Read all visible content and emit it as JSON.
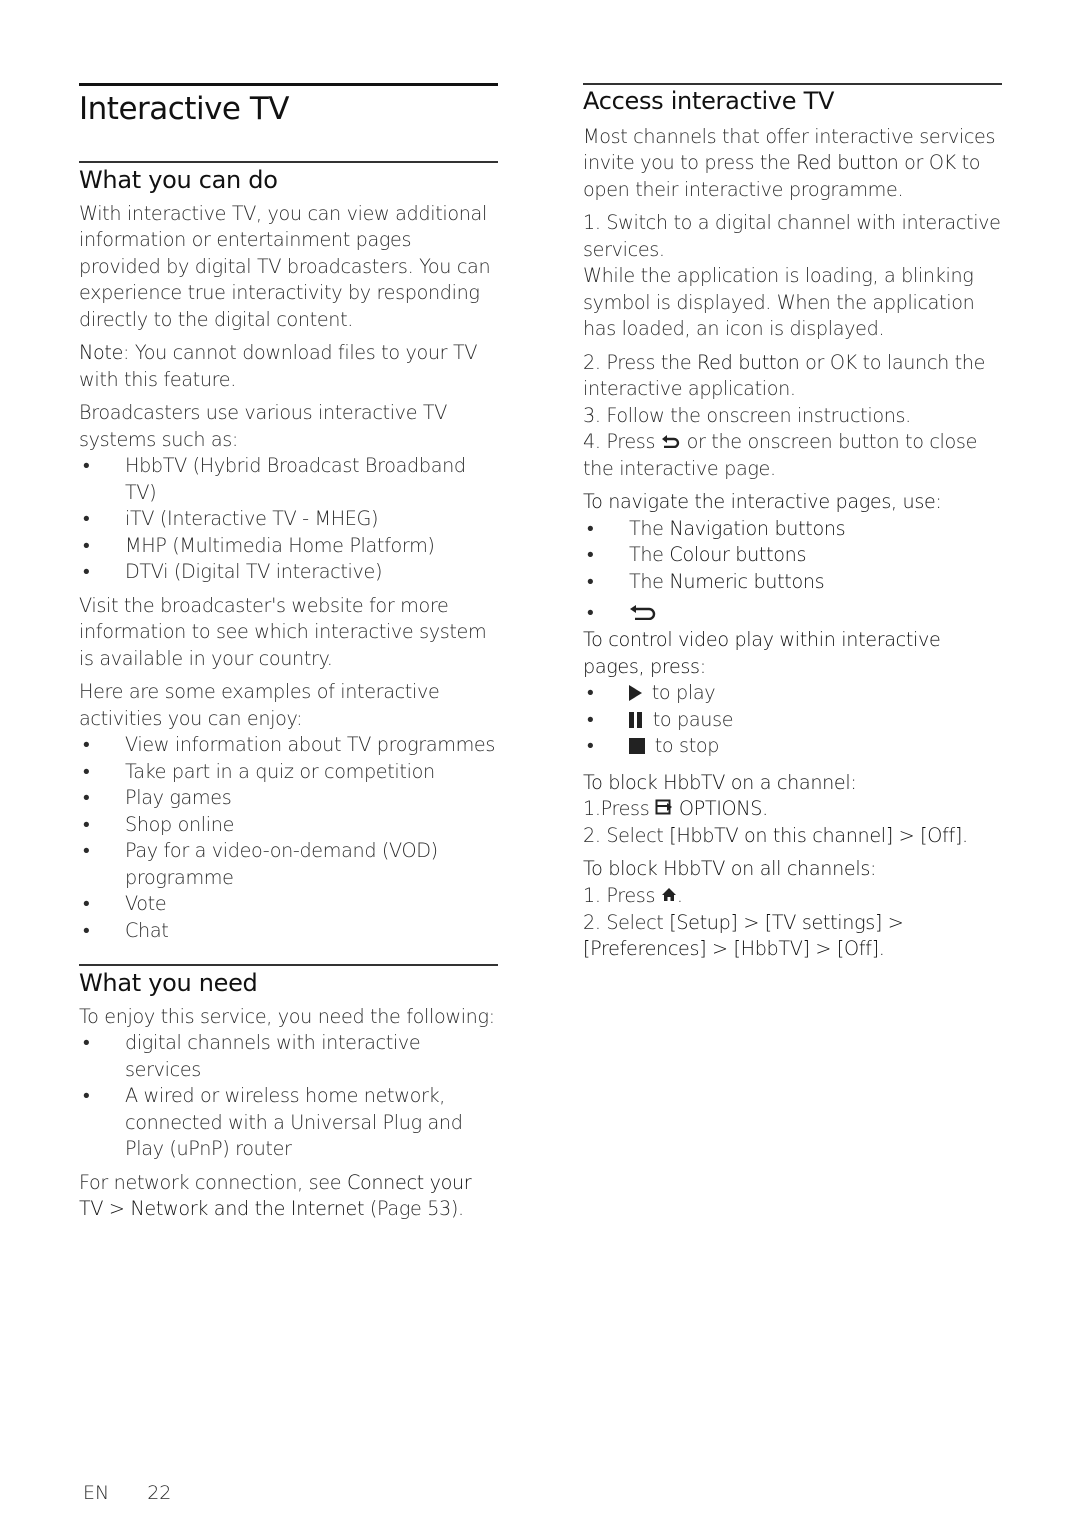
{
  "page": {
    "title": "Interactive TV",
    "footer": {
      "lang": "EN",
      "page_number": "22"
    }
  },
  "what_you_can_do": {
    "heading": "What you can do",
    "intro": "With interactive TV, you can view additional information or entertainment pages provided by digital TV broadcasters. You can experience true interactivity by responding directly to the digital content.",
    "note_label": "Note",
    "note_text": ": You cannot download files to your TV with this feature.",
    "systems_intro": "Broadcasters use various interactive TV systems such as:",
    "systems": [
      "HbbTV (Hybrid Broadcast Broadband TV)",
      "iTV (Interactive TV - MHEG)",
      "MHP (Multimedia Home Platform)",
      "DTVi (Digital TV interactive)"
    ],
    "visit_text": "Visit the broadcaster's website for more information to see which interactive system is available in your country.",
    "examples_intro": "Here are some examples of interactive activities you can enjoy:",
    "examples": [
      "View information about TV programmes",
      "Take part in a quiz or competition",
      "Play games",
      "Shop online",
      "Pay for a video-on-demand (VOD) programme",
      "Vote",
      "Chat"
    ]
  },
  "what_you_need": {
    "heading": "What you need",
    "intro": "To enjoy this service, you need the following:",
    "items": [
      "digital channels with interactive services",
      "A wired or wireless home network, connected with a Universal Plug and Play (uPnP) router"
    ],
    "see_prefix": "For network connection, see ",
    "see_link": "Connect your TV > Network and the Internet",
    "see_suffix": " (Page 53)."
  },
  "access": {
    "heading": "Access interactive TV",
    "intro_a": "Most channels that offer interactive services invite you to press the ",
    "red_button": "Red button",
    "intro_b": " or OK to open their interactive programme.",
    "step1": "1. Switch to a digital channel with interactive services.",
    "step1_note": "While the application is loading, a blinking symbol is displayed. When the application has loaded, an icon is displayed.",
    "step2_a": "2. Press the ",
    "step2_red": "Red button",
    "step2_b": " or OK to launch the interactive application.",
    "step3": "3. Follow the onscreen instructions.",
    "step4_a": "4. Press ",
    "step4_icon": "back-icon",
    "step4_b": " or the onscreen button to close the interactive page.",
    "navigate_intro": "To navigate the interactive pages, use:",
    "navigate_items": [
      {
        "prefix": "The ",
        "label": "Navigation buttons"
      },
      {
        "prefix": "The ",
        "label": "Colour buttons"
      },
      {
        "prefix": "The ",
        "label": "Numeric buttons"
      },
      {
        "prefix": "",
        "label": "",
        "icon": "back-icon"
      }
    ],
    "video_intro": "To control video play within interactive pages, press:",
    "video_items": [
      {
        "icon": "play-icon",
        "label": " to play"
      },
      {
        "icon": "pause-icon",
        "label": " to pause"
      },
      {
        "icon": "stop-icon",
        "label": " to stop"
      }
    ],
    "block_channel_intro": "To block HbbTV on a channel:",
    "block_channel_step1_a": "1.Press ",
    "block_channel_step1_icon": "options-icon",
    "block_channel_step1_b": " OPTIONS.",
    "block_channel_step2_a": "2. Select ",
    "block_channel_step2_b": "[HbbTV on this channel] > [Off].",
    "block_all_intro": "To block HbbTV on all channels:",
    "block_all_step1_a": "1. Press ",
    "block_all_step1_icon": "home-icon",
    "block_all_step1_b": ".",
    "block_all_step2_a": "2. Select ",
    "block_all_step2_b": "[Setup] > [TV settings] > [Preferences] > [HbbTV] > [Off]."
  }
}
